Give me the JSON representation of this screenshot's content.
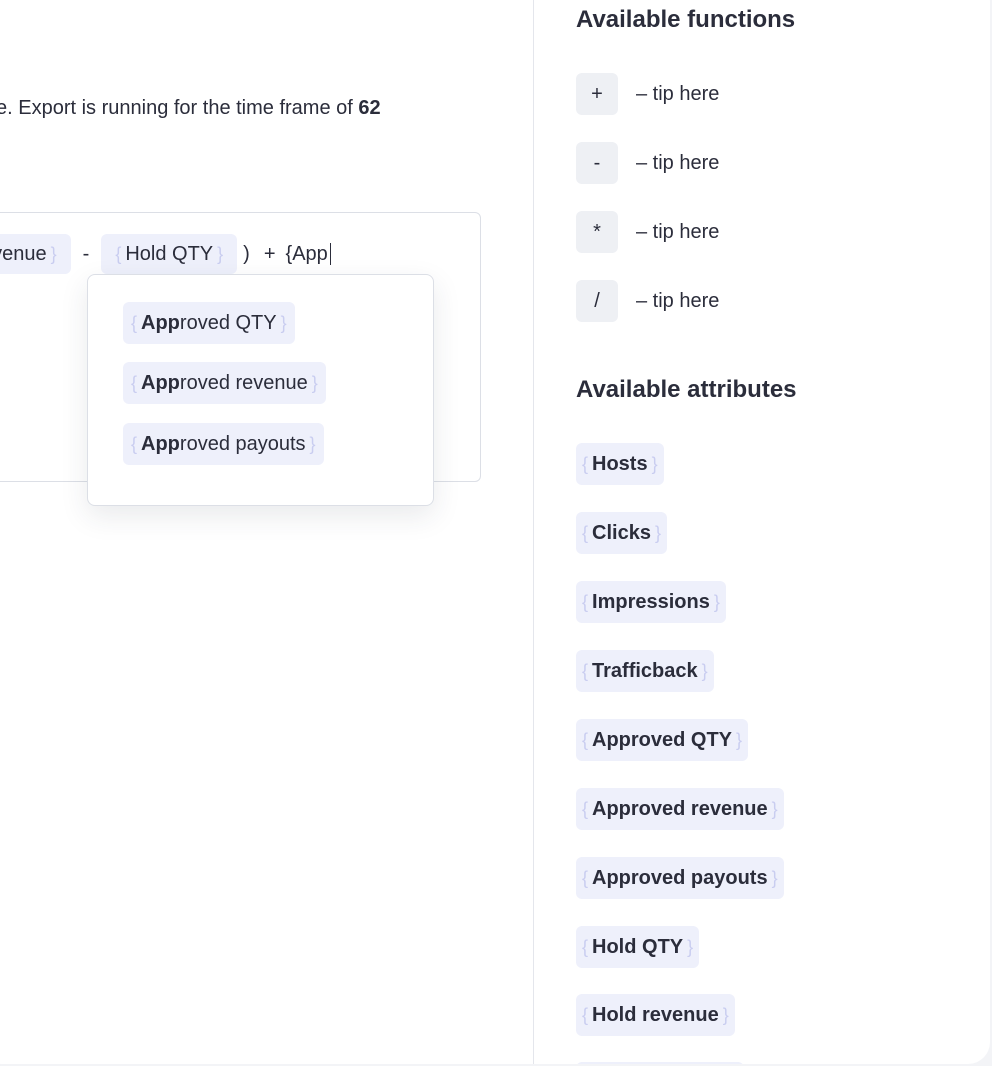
{
  "description": {
    "text": "e. Export is running for the time frame of ",
    "bold": "62"
  },
  "formula": {
    "token1": "evenue",
    "op1": "-",
    "token2": "Hold QTY",
    "close_paren": ")",
    "op2": "+",
    "typed": "{App"
  },
  "autocomplete": {
    "items": [
      {
        "match": "App",
        "rest": "roved QTY"
      },
      {
        "match": "App",
        "rest": "roved revenue"
      },
      {
        "match": "App",
        "rest": "roved payouts"
      }
    ]
  },
  "functions": {
    "title": "Available functions",
    "items": [
      {
        "symbol": "+",
        "tip": "– tip here"
      },
      {
        "symbol": "-",
        "tip": "– tip here"
      },
      {
        "symbol": "*",
        "tip": "– tip here"
      },
      {
        "symbol": "/",
        "tip": "– tip here"
      }
    ]
  },
  "attributes": {
    "title": "Available attributes",
    "items": [
      "Hosts",
      "Clicks",
      "Impressions",
      "Trafficback",
      "Approved QTY",
      "Approved revenue",
      "Approved payouts",
      "Hold QTY",
      "Hold revenue"
    ]
  },
  "colors": {
    "token_bg": "#eef0fb",
    "brace": "#c9cdf0",
    "text": "#2b2d3b",
    "border": "#dcdfe6"
  }
}
